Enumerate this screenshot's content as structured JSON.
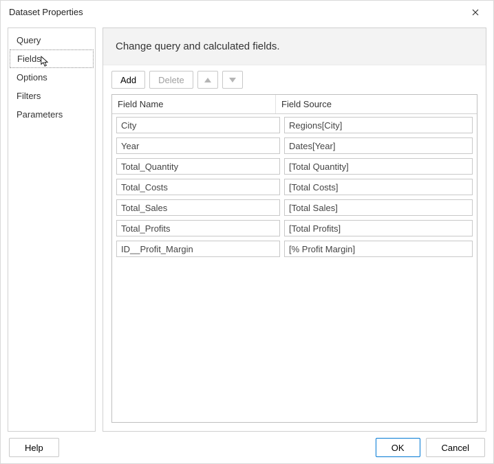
{
  "titlebar": {
    "title": "Dataset Properties"
  },
  "sidebar": {
    "items": [
      {
        "label": "Query"
      },
      {
        "label": "Fields"
      },
      {
        "label": "Options"
      },
      {
        "label": "Filters"
      },
      {
        "label": "Parameters"
      }
    ],
    "selected_index": 1
  },
  "main": {
    "header": "Change query and calculated fields.",
    "toolbar": {
      "add_label": "Add",
      "delete_label": "Delete"
    },
    "columns": {
      "field_name": "Field Name",
      "field_source": "Field Source"
    },
    "rows": [
      {
        "name": "City",
        "source": "Regions[City]"
      },
      {
        "name": "Year",
        "source": "Dates[Year]"
      },
      {
        "name": "Total_Quantity",
        "source": "[Total Quantity]"
      },
      {
        "name": "Total_Costs",
        "source": "[Total Costs]"
      },
      {
        "name": "Total_Sales",
        "source": "[Total Sales]"
      },
      {
        "name": "Total_Profits",
        "source": "[Total Profits]"
      },
      {
        "name": "ID__Profit_Margin",
        "source": "[% Profit Margin]"
      }
    ]
  },
  "footer": {
    "help_label": "Help",
    "ok_label": "OK",
    "cancel_label": "Cancel"
  }
}
